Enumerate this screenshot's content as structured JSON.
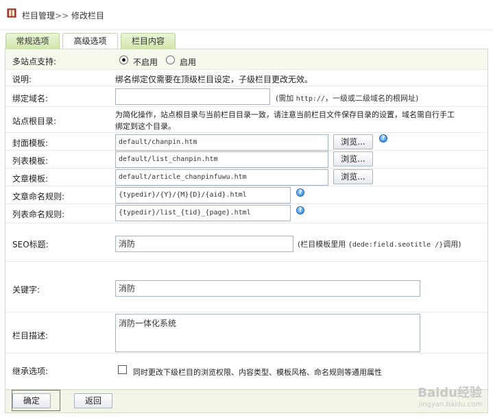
{
  "breadcrumb": {
    "root": "栏目管理",
    "separator": ">>",
    "current": "修改栏目"
  },
  "tabs": [
    {
      "label": "常规选项"
    },
    {
      "label": "高级选项"
    },
    {
      "label": "栏目内容"
    }
  ],
  "form": {
    "multisite": {
      "label": "多站点支持:",
      "option_off": "不启用",
      "option_on": "启用",
      "selected": "不启用"
    },
    "note": {
      "label": "说明:",
      "text": "绑名绑定仅需要在顶级栏目设定，子级栏目更改无效。"
    },
    "bind_domain": {
      "label": "绑定域名:",
      "value": "",
      "hint_prefix": "(需加 ",
      "hint_mono": "http://",
      "hint_suffix": "，一级或二级域名的根网址)"
    },
    "site_root": {
      "label": "站点根目录:",
      "text_line1": "为简化操作，站点根目录与当前栏目目录一致，请注意当前栏目文件保存目录的设置，域名需自行手工",
      "text_line2": "绑定到这个目录。"
    },
    "cover_template": {
      "label": "封面模板:",
      "value": "default/chanpin.htm",
      "browse": "浏览..."
    },
    "list_template": {
      "label": "列表模板:",
      "value": "default/list_chanpin.htm",
      "browse": "浏览..."
    },
    "article_template": {
      "label": "文章模板:",
      "value": "default/article_chanpinfuwu.htm",
      "browse": "浏览..."
    },
    "article_naming": {
      "label": "文章命名规则:",
      "value": "{typedir}/{Y}/{M}{D}/{aid}.html"
    },
    "list_naming": {
      "label": "列表命名规则:",
      "value": "{typedir}/list_{tid}_{page}.html"
    },
    "seo_title": {
      "label": "SEO标题:",
      "value": "消防",
      "hint_prefix": "(栏目模板里用 ",
      "hint_mono": "{dede:field.seotitle /}",
      "hint_suffix": "调用)"
    },
    "keywords": {
      "label": "关键字:",
      "value": "消防"
    },
    "description": {
      "label": "栏目描述:",
      "value": "消防一体化系统"
    },
    "inherit": {
      "label": "继承选项:",
      "text": "同时更改下级栏目的浏览权限、内容类型、模板风格、命名规则等通用属性",
      "checked": false
    }
  },
  "buttons": {
    "ok": "确定",
    "back": "返回"
  },
  "help_icon_glyph": "?",
  "watermark": {
    "brand": "Baidu经验",
    "url": "jingyan.baidu.com"
  },
  "colors": {
    "tab_green": "#cfe6a9",
    "row_shade": "#f4f9ec",
    "border": "#cfdcbf",
    "highlight_red": "#e04040"
  }
}
